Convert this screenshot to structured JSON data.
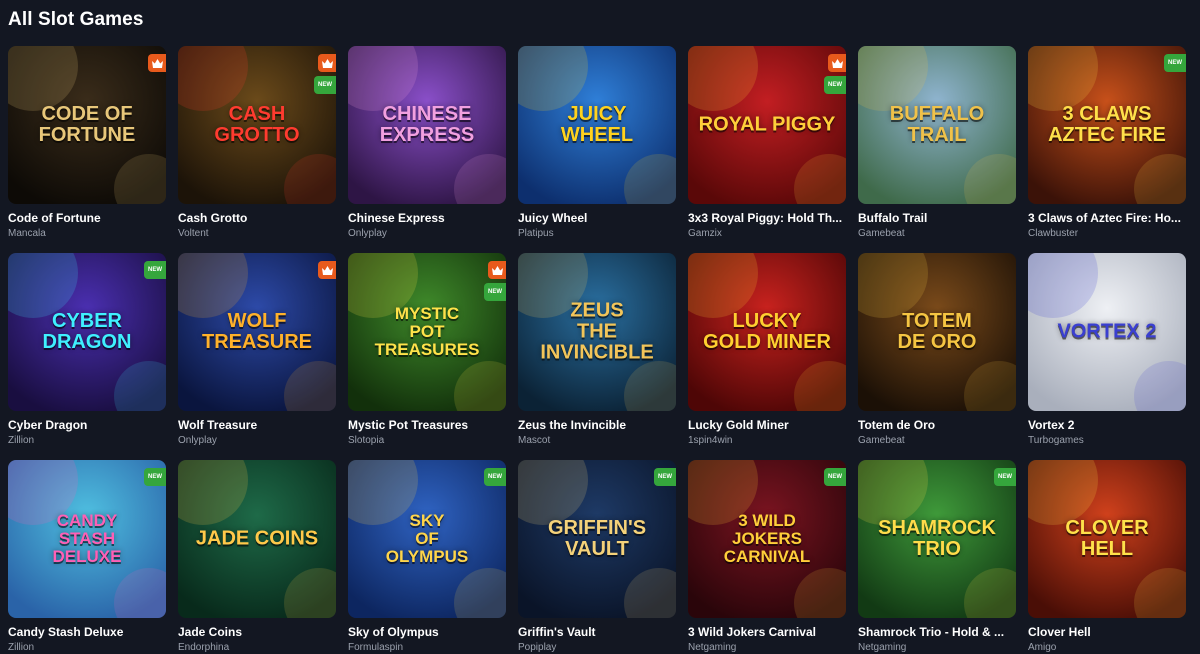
{
  "section": {
    "title": "All Slot Games"
  },
  "games": [
    {
      "name": "Code of Fortune",
      "provider": "Mancala",
      "art": "CODE OF\nFORTUNE",
      "hot": true,
      "new": false,
      "bg": [
        "#3a2c1a",
        "#0d0a06"
      ],
      "color": "#e8c77a"
    },
    {
      "name": "Cash Grotto",
      "provider": "Voltent",
      "art": "CASH GROTTO",
      "hot": true,
      "new": true,
      "bg": [
        "#6b4a1a",
        "#1c1308"
      ],
      "color": "#ff3b2f"
    },
    {
      "name": "Chinese Express",
      "provider": "Onlyplay",
      "art": "CHINESE\nEXPRESS",
      "hot": false,
      "new": false,
      "bg": [
        "#8a4fc9",
        "#2e1545"
      ],
      "color": "#f2a0e0"
    },
    {
      "name": "Juicy Wheel",
      "provider": "Platipus",
      "art": "JUICY\nWHEEL",
      "hot": false,
      "new": false,
      "bg": [
        "#2f7fd8",
        "#0d2f6e"
      ],
      "color": "#ffd21e"
    },
    {
      "name": "3x3 Royal Piggy: Hold Th...",
      "provider": "Gamzix",
      "art": "ROYAL PIGGY",
      "hot": true,
      "new": true,
      "bg": [
        "#c21e22",
        "#5a0808"
      ],
      "color": "#ffcf3a"
    },
    {
      "name": "Buffalo Trail",
      "provider": "Gamebeat",
      "art": "BUFFALO TRAIL",
      "hot": false,
      "new": false,
      "bg": [
        "#8fb4cf",
        "#3f6a4a"
      ],
      "color": "#f0c24a"
    },
    {
      "name": "3 Claws of Aztec Fire: Ho...",
      "provider": "Clawbuster",
      "art": "3 CLAWS\nAZTEC FIRE",
      "hot": false,
      "new": true,
      "bg": [
        "#c7501a",
        "#3b1208"
      ],
      "color": "#ffe04a"
    },
    {
      "name": "Cyber Dragon",
      "provider": "Zillion",
      "art": "CYBER\nDRAGON",
      "hot": false,
      "new": true,
      "bg": [
        "#4a2fb0",
        "#190e40"
      ],
      "color": "#3ff0ff"
    },
    {
      "name": "Wolf Treasure",
      "provider": "Onlyplay",
      "art": "WOLF\nTREASURE",
      "hot": true,
      "new": false,
      "bg": [
        "#2d4aa8",
        "#0a153e"
      ],
      "color": "#ffb12a"
    },
    {
      "name": "Mystic Pot Treasures",
      "provider": "Slotopia",
      "art": "MYSTIC\nPOT\nTREASURES",
      "hot": true,
      "new": true,
      "bg": [
        "#3f8a2a",
        "#12300b"
      ],
      "color": "#ffe24a"
    },
    {
      "name": "Zeus the Invincible",
      "provider": "Mascot",
      "art": "ZEUS\nTHE INVINCIBLE",
      "hot": false,
      "new": false,
      "bg": [
        "#2a6fa0",
        "#0b2235"
      ],
      "color": "#f2c55a"
    },
    {
      "name": "Lucky Gold Miner",
      "provider": "1spin4win",
      "art": "LUCKY\nGOLD MINER",
      "hot": false,
      "new": false,
      "bg": [
        "#c8221e",
        "#4e0606"
      ],
      "color": "#ffd030"
    },
    {
      "name": "Totem de Oro",
      "provider": "Gamebeat",
      "art": "TOTEM\nDE ORO",
      "hot": false,
      "new": false,
      "bg": [
        "#7a4a1a",
        "#1b1006"
      ],
      "color": "#f5c542"
    },
    {
      "name": "Vortex 2",
      "provider": "Turbogames",
      "art": "VORTEX 2",
      "hot": false,
      "new": false,
      "bg": [
        "#eef0f4",
        "#a9afbc"
      ],
      "color": "#3a3fd0"
    },
    {
      "name": "Candy Stash Deluxe",
      "provider": "Zillion",
      "art": "CANDY\nSTASH\nDELUXE",
      "hot": false,
      "new": true,
      "bg": [
        "#4fbfe0",
        "#2a63a8"
      ],
      "color": "#ff5fb5"
    },
    {
      "name": "Jade Coins",
      "provider": "Endorphina",
      "art": "JADE COINS",
      "hot": false,
      "new": false,
      "bg": [
        "#1e6a48",
        "#082a1b"
      ],
      "color": "#ffc94a"
    },
    {
      "name": "Sky of Olympus",
      "provider": "Formulaspin",
      "art": "SKY\nOF\nOLYMPUS",
      "hot": false,
      "new": true,
      "bg": [
        "#2f63c2",
        "#0d2660"
      ],
      "color": "#ffd54a"
    },
    {
      "name": "Griffin's Vault",
      "provider": "Popiplay",
      "art": "GRIFFIN'S\nVAULT",
      "hot": false,
      "new": true,
      "bg": [
        "#1e3a66",
        "#0a1428"
      ],
      "color": "#f5d27a"
    },
    {
      "name": "3 Wild Jokers Carnival",
      "provider": "Netgaming",
      "art": "3 WILD\nJOKERS\nCARNIVAL",
      "hot": false,
      "new": true,
      "bg": [
        "#7a1420",
        "#2a050a"
      ],
      "color": "#ffcf3a"
    },
    {
      "name": "Shamrock Trio - Hold & ...",
      "provider": "Netgaming",
      "art": "SHAMROCK\nTRIO",
      "hot": false,
      "new": true,
      "bg": [
        "#3f9a3a",
        "#123a14"
      ],
      "color": "#ffdc4a"
    },
    {
      "name": "Clover Hell",
      "provider": "Amigo",
      "art": "CLOVER\nHELL",
      "hot": false,
      "new": false,
      "bg": [
        "#d0411c",
        "#4a0e06"
      ],
      "color": "#ffe14a"
    }
  ],
  "badges": {
    "new_label": "NEW",
    "hot_icon": "crown-icon"
  }
}
